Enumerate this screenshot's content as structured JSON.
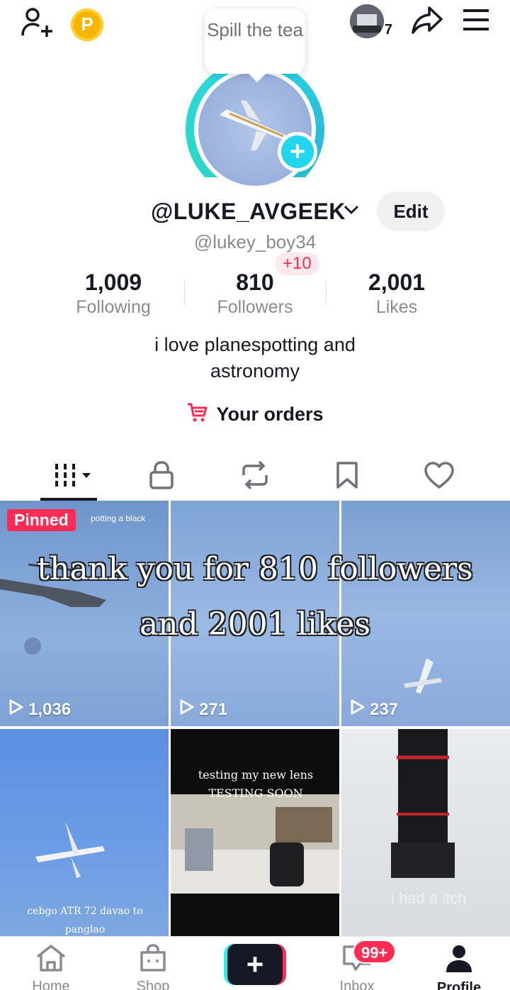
{
  "header": {
    "coin_letter": "P",
    "notification_count": "7",
    "tooltip": "Spill the tea"
  },
  "profile": {
    "display_name": "@LUKE_AVGEEK",
    "edit_label": "Edit",
    "handle": "@lukey_boy34",
    "stats": [
      {
        "value": "1,009",
        "label": "Following"
      },
      {
        "value": "810",
        "label": "Followers"
      },
      {
        "value": "2,001",
        "label": "Likes"
      }
    ],
    "new_followers": "+10",
    "bio_line1": "i love planespotting and",
    "bio_line2": "astronomy",
    "orders_label": "Your orders"
  },
  "grid": {
    "overlay_line1": "thank you for 810 followers",
    "overlay_line2": "and 2001 likes",
    "pinned_label": "Pinned",
    "videos": [
      {
        "views": "1,036",
        "caption": "potting a black"
      },
      {
        "views": "271",
        "caption": ""
      },
      {
        "views": "237",
        "caption": ""
      },
      {
        "views": "",
        "caption": "cebgo ATR 72 davao to panglao"
      },
      {
        "views": "",
        "caption": "testing my new lens TESTING SOON"
      },
      {
        "views": "",
        "caption": "i had a itch"
      }
    ]
  },
  "bottom_nav": {
    "home": "Home",
    "shop": "Shop",
    "inbox": "Inbox",
    "inbox_badge": "99+",
    "profile": "Profile"
  }
}
